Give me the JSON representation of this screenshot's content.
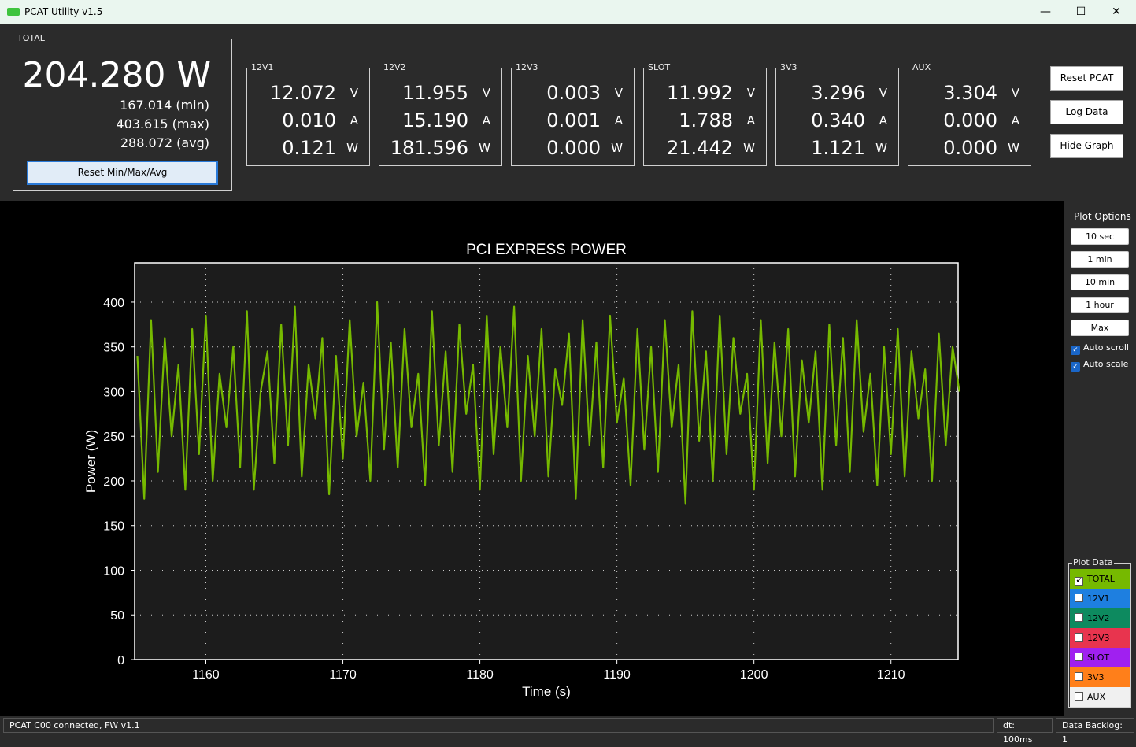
{
  "window": {
    "title": "PCAT Utility v1.5",
    "minimize": "—",
    "maximize": "☐",
    "close": "✕"
  },
  "total": {
    "label": "TOTAL",
    "power": "204.280 W",
    "min": "167.014 (min)",
    "max": "403.615 (max)",
    "avg": "288.072 (avg)",
    "reset_label": "Reset Min/Max/Avg"
  },
  "rails": [
    {
      "label": "12V1",
      "v": "12.072",
      "a": "0.010",
      "w": "0.121"
    },
    {
      "label": "12V2",
      "v": "11.955",
      "a": "15.190",
      "w": "181.596"
    },
    {
      "label": "12V3",
      "v": "0.003",
      "a": "0.001",
      "w": "0.000"
    },
    {
      "label": "SLOT",
      "v": "11.992",
      "a": "1.788",
      "w": "21.442"
    },
    {
      "label": "3V3",
      "v": "3.296",
      "a": "0.340",
      "w": "1.121"
    },
    {
      "label": "AUX",
      "v": "3.304",
      "a": "0.000",
      "w": "0.000"
    }
  ],
  "units": {
    "v": "V",
    "a": "A",
    "w": "W"
  },
  "side_buttons": [
    "Reset PCAT",
    "Log Data",
    "Hide Graph"
  ],
  "plot_options": {
    "title": "Plot Options",
    "buttons": [
      "10 sec",
      "1 min",
      "10 min",
      "1 hour",
      "Max"
    ],
    "auto_scroll": {
      "label": "Auto scroll",
      "checked": true
    },
    "auto_scale": {
      "label": "Auto scale",
      "checked": true
    }
  },
  "plot_data": {
    "title": "Plot Data",
    "items": [
      {
        "label": "TOTAL",
        "color": "#76b900",
        "checked": true
      },
      {
        "label": "12V1",
        "color": "#1e7fe0",
        "checked": false
      },
      {
        "label": "12V2",
        "color": "#0d8a5f",
        "checked": false
      },
      {
        "label": "12V3",
        "color": "#e8344e",
        "checked": false
      },
      {
        "label": "SLOT",
        "color": "#a020f0",
        "checked": false
      },
      {
        "label": "3V3",
        "color": "#ff7f1a",
        "checked": false
      },
      {
        "label": "AUX",
        "color": "#f0f0f0",
        "checked": false
      }
    ]
  },
  "status": {
    "connection": "PCAT C00 connected, FW v1.1",
    "dt": "dt: 100ms",
    "backlog": "Data Backlog: 1"
  },
  "chart_data": {
    "type": "line",
    "title": "PCI EXPRESS POWER",
    "xlabel": "Time (s)",
    "ylabel": "Power (W)",
    "xlim": [
      1154.8,
      1214.9
    ],
    "ylim": [
      0,
      444
    ],
    "grid": true,
    "line_color": "#76b900",
    "xticks": [
      1160,
      1170,
      1180,
      1190,
      1200,
      1210
    ],
    "yticks": [
      0,
      50,
      100,
      150,
      200,
      250,
      300,
      350,
      400
    ],
    "series": [
      {
        "x0": 1155,
        "dx": 0.5,
        "values": [
          340,
          180,
          380,
          210,
          360,
          250,
          330,
          190,
          370,
          230,
          385,
          200,
          320,
          260,
          350,
          215,
          390,
          190,
          300,
          345,
          220,
          375,
          240,
          395,
          205,
          330,
          270,
          360,
          185,
          340,
          225,
          380,
          250,
          310,
          200,
          400,
          235,
          355,
          215,
          370,
          260,
          320,
          195,
          390,
          240,
          345,
          210,
          375,
          275,
          330,
          190,
          385,
          230,
          350,
          260,
          395,
          200,
          340,
          250,
          370,
          205,
          325,
          285,
          365,
          180,
          380,
          240,
          355,
          215,
          385,
          265,
          315,
          195,
          370,
          235,
          350,
          210,
          380,
          260,
          330,
          175,
          390,
          245,
          345,
          200,
          385,
          230,
          360,
          275,
          320,
          190,
          380,
          220,
          355,
          250,
          370,
          205,
          335,
          265,
          345,
          190,
          375,
          240,
          360,
          210,
          380,
          255,
          320,
          195,
          350,
          230,
          370,
          205,
          345,
          270,
          325,
          200,
          365,
          240,
          350,
          300
        ]
      }
    ]
  }
}
